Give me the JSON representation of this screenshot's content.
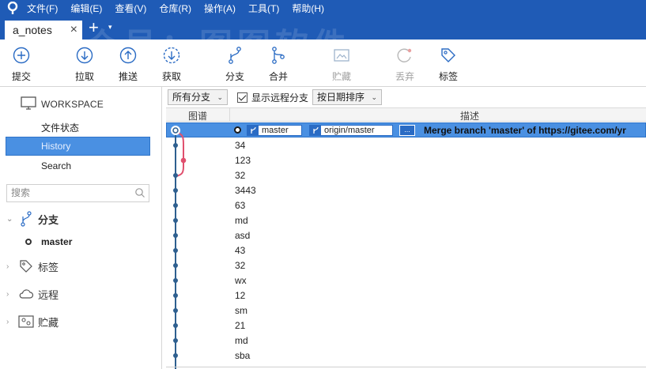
{
  "menu": [
    "文件(F)",
    "编辑(E)",
    "查看(V)",
    "仓库(R)",
    "操作(A)",
    "工具(T)",
    "帮助(H)"
  ],
  "tab": {
    "title": "a_notes",
    "close": "×",
    "add": "+",
    "more": "▾"
  },
  "watermark": "公众号：图图软件",
  "toolbar": [
    {
      "label": "提交",
      "icon": "commit-icon"
    },
    {
      "label": "拉取",
      "icon": "pull-icon"
    },
    {
      "label": "推送",
      "icon": "push-icon"
    },
    {
      "label": "获取",
      "icon": "fetch-icon"
    },
    {
      "label": "分支",
      "icon": "branch-icon"
    },
    {
      "label": "合并",
      "icon": "merge-icon"
    },
    {
      "label": "贮藏",
      "icon": "stash-icon",
      "disabled": true
    },
    {
      "label": "丢弃",
      "icon": "discard-icon",
      "disabled": true
    },
    {
      "label": "标签",
      "icon": "tag-icon"
    }
  ],
  "sidebar": {
    "workspace_title": "WORKSPACE",
    "nav": [
      "文件状态",
      "History",
      "Search"
    ],
    "selected_nav": "History",
    "search_placeholder": "搜索",
    "sections": {
      "branches": "分支",
      "tags": "标签",
      "remotes": "远程",
      "stashes": "贮藏"
    },
    "branch_items": [
      "master"
    ]
  },
  "filters": {
    "branch_filter": "所有分支",
    "show_remote_label": "显示远程分支",
    "show_remote_checked": true,
    "sort": "按日期排序"
  },
  "columns": {
    "graph": "图谱",
    "description": "描述"
  },
  "head": {
    "local_branch": "master",
    "remote_branch": "origin/master",
    "more": "...",
    "message": "Merge branch 'master' of https://gitee.com/yr"
  },
  "commits": [
    "34",
    "123",
    "32",
    "3443",
    "63",
    "md",
    "asd",
    "43",
    "32",
    "wx",
    "12",
    "sm",
    "21",
    "md",
    "sba"
  ],
  "colors": {
    "title_bar": "#1f5bb6",
    "selection": "#4a90e2",
    "graph_main": "#2e5f8f",
    "graph_branch": "#e0506e"
  }
}
